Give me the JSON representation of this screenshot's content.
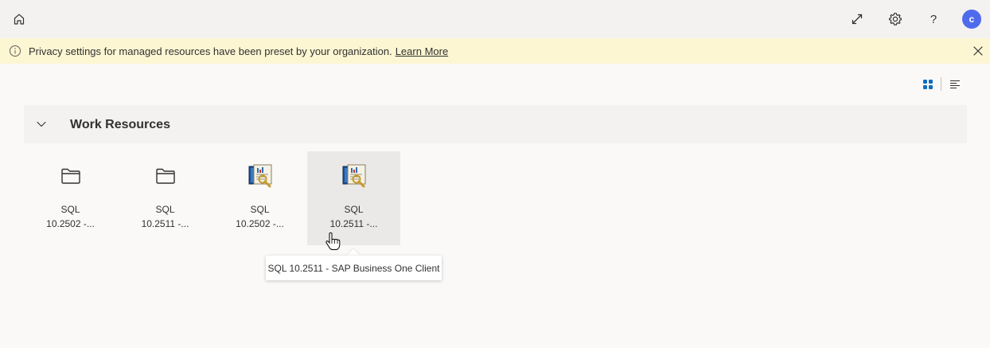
{
  "topbar": {
    "icons": {
      "home": "home-icon",
      "expand": "expand-icon",
      "settings": "gear-icon",
      "help": "help-icon"
    },
    "help_label": "?",
    "avatar_initial": "c",
    "avatar_color": "#4f6bed"
  },
  "banner": {
    "text": "Privacy settings for managed resources have been preset by your organization.",
    "link": "Learn More",
    "background": "#fdf6d3"
  },
  "section": {
    "title": "Work Resources",
    "tiles": [
      {
        "line1": "SQL",
        "line2": "10.2502 -...",
        "icon": "folder-icon"
      },
      {
        "line1": "SQL",
        "line2": "10.2511 -...",
        "icon": "folder-icon"
      },
      {
        "line1": "SQL",
        "line2": "10.2502 -...",
        "icon": "sap-app-icon"
      },
      {
        "line1": "SQL",
        "line2": "10.2511 -...",
        "icon": "sap-app-icon"
      }
    ]
  },
  "tooltip": {
    "text": "SQL 10.2511 - SAP Business One Client"
  },
  "accent_color": "#0f6cbd"
}
